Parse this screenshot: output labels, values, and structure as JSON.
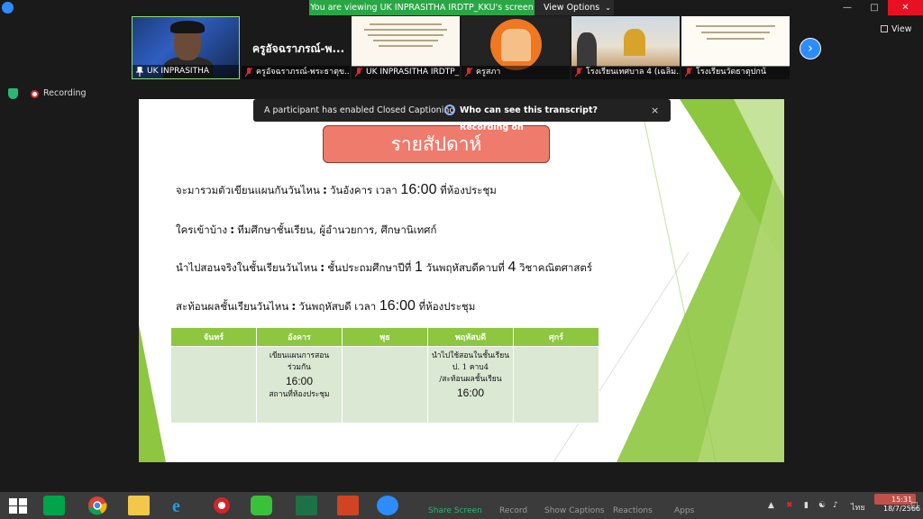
{
  "window": {
    "viewing_banner": "You are viewing UK INPRASITHA IRDTP_KKU's screen",
    "view_options": "View Options",
    "view_button": "View",
    "recording": "Recording"
  },
  "thumbnails": [
    {
      "label": "UK INPRASITHA"
    },
    {
      "label": "ครูอัจฉราภรณ์-พระธาตุข...",
      "display_name": "ครูอัจฉราภรณ์-พ..."
    },
    {
      "label": "UK INPRASITHA IRDTP_K..."
    },
    {
      "label": "ครูสภา"
    },
    {
      "label": "โรงเรียนเทศบาล 4 (เฉลิม..."
    },
    {
      "label": "โรงเรียนวัดธาตุปกน้"
    }
  ],
  "cc": {
    "notice": "A participant has enabled Closed Captioning",
    "who": "Who can see this transcript? Recording on",
    "close": "×"
  },
  "slide": {
    "title": "รายสัปดาห์",
    "rows": [
      {
        "label": "จะมารวมตัวเขียนแผนกันวันไหน",
        "pre": "วันอังคาร เวลา",
        "big": "16:00",
        "post": "ที่ห้องประชุม"
      },
      {
        "label": "ใครเข้าบ้าง",
        "pre": "ทีมศึกษาชั้นเรียน, ผู้อำนวยการ, ศึกษานิเทศก์",
        "big": "",
        "post": ""
      },
      {
        "label": "นำไปสอนจริงในชั้นเรียนวันไหน",
        "pre": "ชั้นประถมศึกษาปีที่",
        "big": "1",
        "post": "วันพฤหัสบดีคาบที่",
        "big2": "4",
        "post2": "วิชาคณิตศาสตร์"
      },
      {
        "label": "สะท้อนผลชั้นเรียนวันไหน",
        "pre": "วันพฤหัสบดี เวลา",
        "big": "16:00",
        "post": "ที่ห้องประชุม"
      }
    ],
    "table": {
      "headers": [
        "จันทร์",
        "อังคาร",
        "พุธ",
        "พฤหัสบดี",
        "ศุกร์"
      ],
      "tue": {
        "line1": "เขียนแผนการสอน",
        "line2": "ร่วมกัน",
        "time": "16:00",
        "line3": "สถานที่ห้องประชุม"
      },
      "thu": {
        "line1": "นำไปใช้สอนในชั้นเรียน",
        "line2": "ป. 1 คาบ4",
        "line3": "/สะท้อนผลชั้นเรียน",
        "time": "16:00"
      }
    }
  },
  "toolbar": {
    "items": [
      "Share Screen",
      "Record",
      "Show Captions",
      "Reactions",
      "Apps"
    ],
    "share_color": "#2bb673"
  },
  "tray": {
    "lang": "ไทย",
    "time": "15:31",
    "date": "18/7/2566"
  },
  "colors": {
    "slide_green": "#8dc63f",
    "title_fill": "#ef7b6d",
    "zoom_blue": "#2d8cff",
    "banner_green": "#29a745"
  }
}
